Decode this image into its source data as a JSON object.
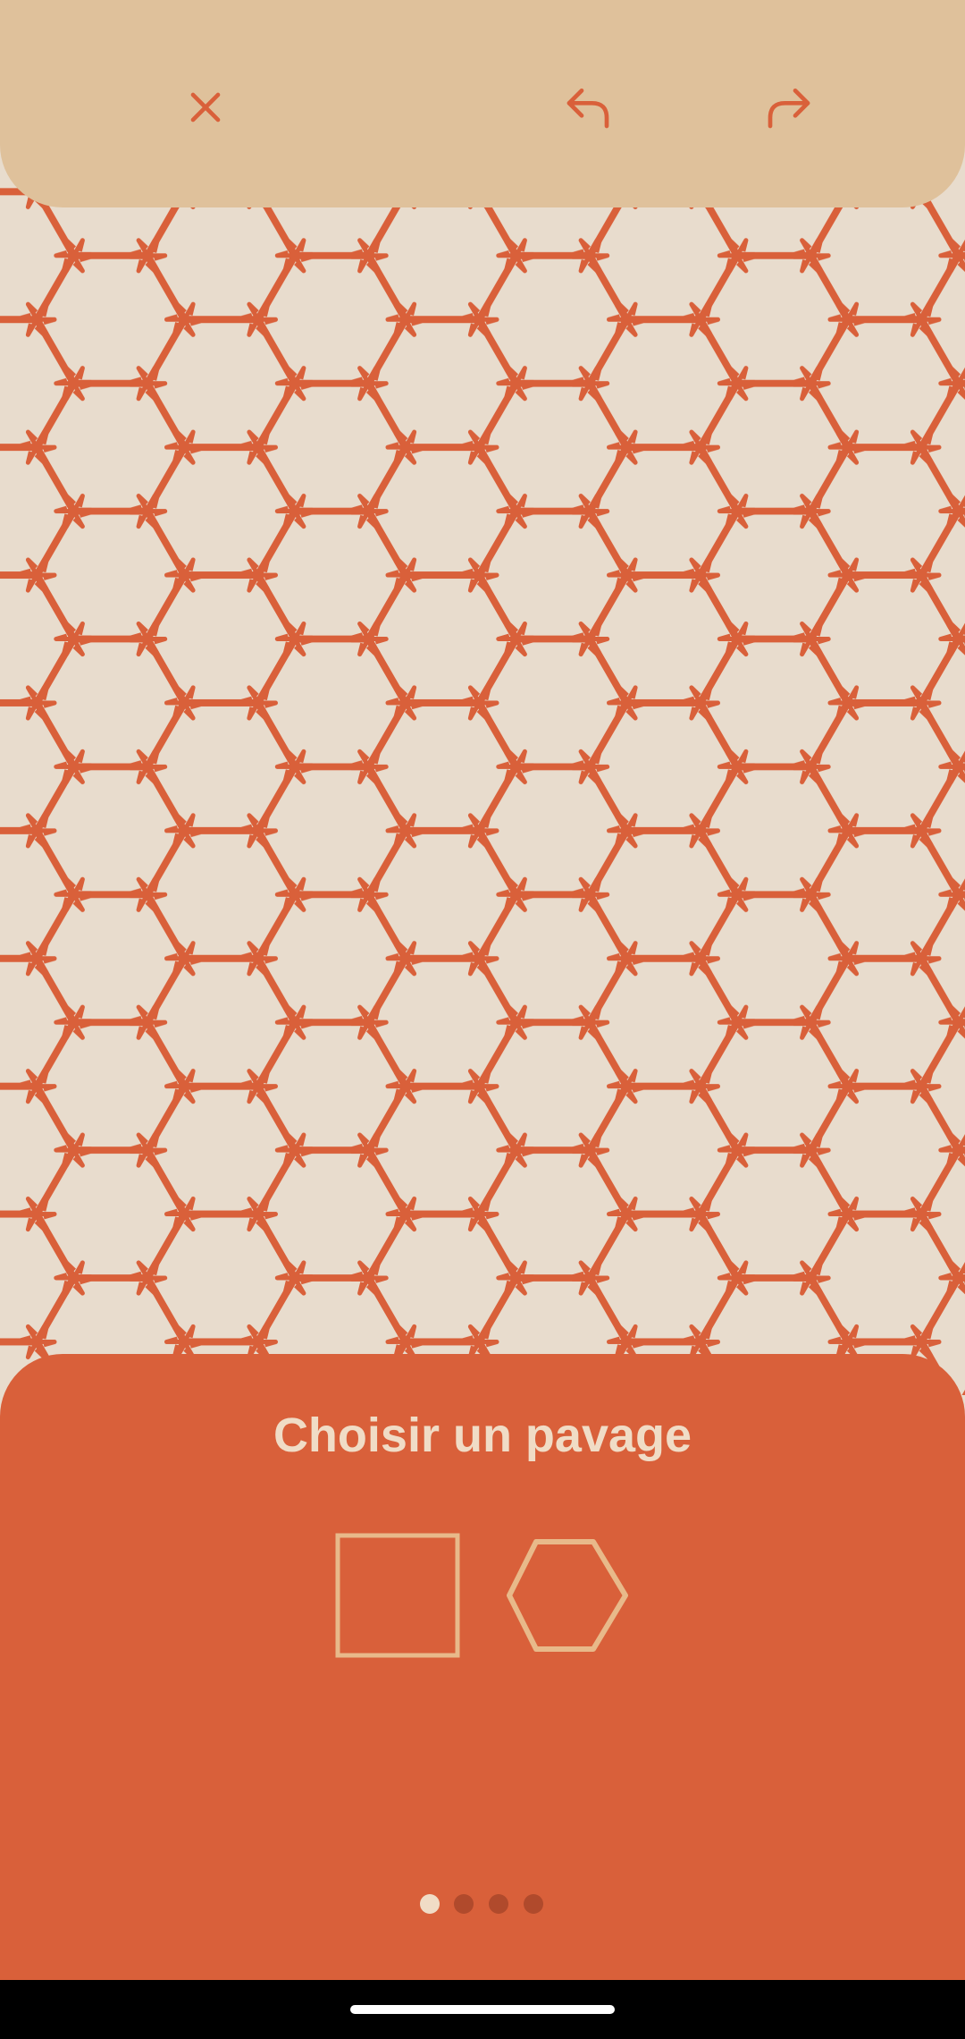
{
  "toolbar": {
    "close_icon": "close-icon",
    "undo_icon": "undo-icon",
    "redo_icon": "redo-icon"
  },
  "pattern": {
    "type": "hexagonal star tiling",
    "line_color": "#d9603a",
    "background_color": "#e8dccd"
  },
  "sheet": {
    "title": "Choisir un pavage",
    "options": [
      {
        "name": "square",
        "icon": "square-icon"
      },
      {
        "name": "hexagon",
        "icon": "hexagon-icon"
      }
    ],
    "page_count": 4,
    "active_page": 1
  },
  "colors": {
    "toolbar_bg": "#dfc19b",
    "accent": "#d9603a",
    "canvas_bg": "#e8dccd",
    "option_stroke": "#e8b98a",
    "title_text": "#f0dcc6",
    "dot_active": "#f0dcc6",
    "dot_inactive": "#b04a2c"
  }
}
